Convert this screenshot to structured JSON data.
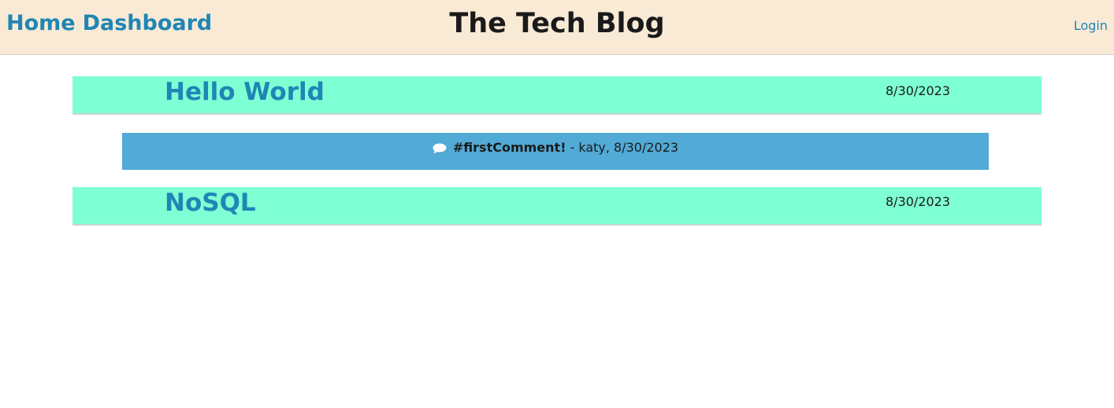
{
  "header": {
    "nav": [
      "Home",
      "Dashboard"
    ],
    "title": "The Tech Blog",
    "login_label": "Login"
  },
  "posts": [
    {
      "title": "Hello World",
      "date": "8/30/2023"
    },
    {
      "title": "NoSQL",
      "date": "8/30/2023"
    }
  ],
  "comments": [
    {
      "icon": "speech-bubble-icon",
      "text": "#firstComment!",
      "meta": "- katy, 8/30/2023"
    }
  ],
  "colors": {
    "header_bg": "#f9ead6",
    "post_bg": "#7fffd4",
    "comment_bg": "#52aad6",
    "link": "#1f86b4"
  }
}
